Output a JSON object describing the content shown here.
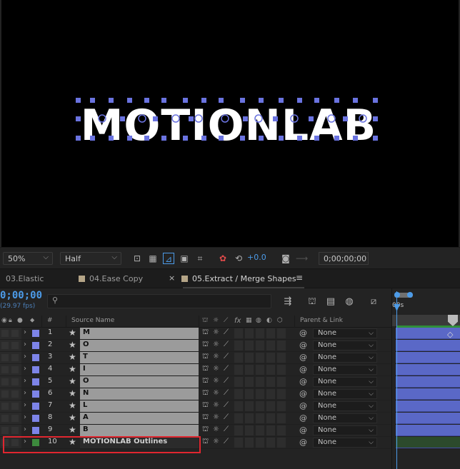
{
  "viewer": {
    "comp_text": "MOTIONLAB",
    "zoom": "50%",
    "resolution": "Half",
    "exposure": "+0.0",
    "timecode": "0;00;00;00"
  },
  "tabs": [
    {
      "label": "03.Elastic",
      "active": false
    },
    {
      "label": "04.Ease Copy",
      "active": false
    },
    {
      "label": "05.Extract / Merge Shapes",
      "active": true
    }
  ],
  "timeline": {
    "current_time": "0;00;00",
    "fps": "(29.97 fps)",
    "ruler_label": "00s",
    "columns": {
      "number": "#",
      "source_name": "Source Name",
      "parent": "Parent & Link",
      "fx": "fx"
    },
    "layers": [
      {
        "num": "1",
        "name": "M",
        "parent": "None"
      },
      {
        "num": "2",
        "name": "O",
        "parent": "None"
      },
      {
        "num": "3",
        "name": "T",
        "parent": "None"
      },
      {
        "num": "4",
        "name": "I",
        "parent": "None"
      },
      {
        "num": "5",
        "name": "O",
        "parent": "None"
      },
      {
        "num": "6",
        "name": "N",
        "parent": "None"
      },
      {
        "num": "7",
        "name": "L",
        "parent": "None"
      },
      {
        "num": "8",
        "name": "A",
        "parent": "None"
      },
      {
        "num": "9",
        "name": "B",
        "parent": "None"
      },
      {
        "num": "10",
        "name": "MOTIONLAB Outlines",
        "parent": "None"
      }
    ]
  },
  "colors": {
    "accent_blue": "#4c9be8",
    "label_purple": "#7d84e8",
    "label_green": "#3d8a3d",
    "highlight_red": "#e0262f",
    "bar_blue": "#5a68c7"
  }
}
